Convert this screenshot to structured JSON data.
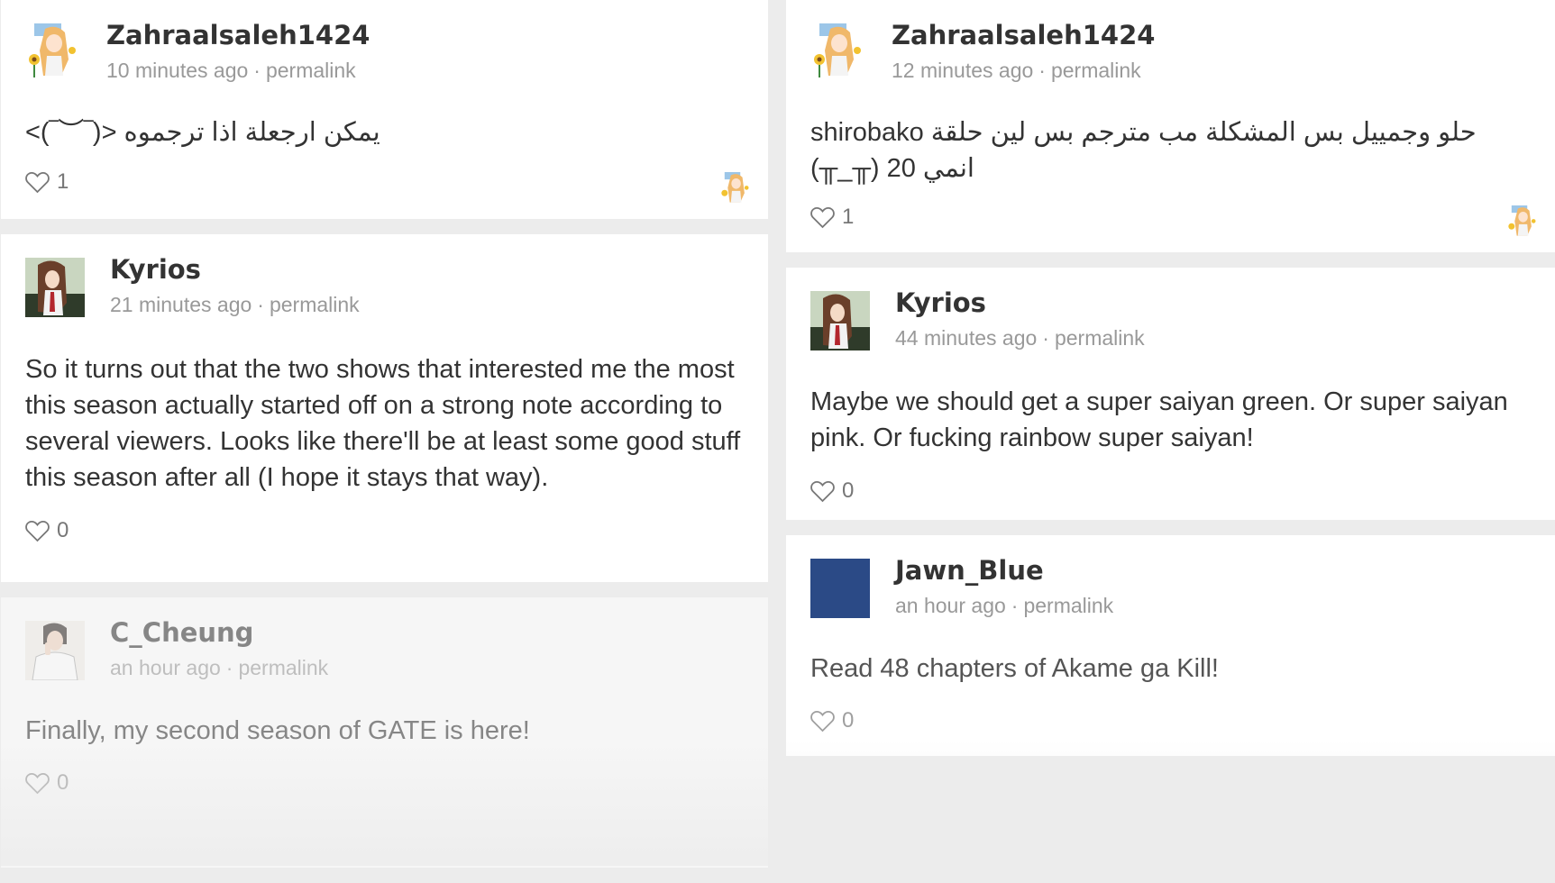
{
  "left_column": [
    {
      "username": "Zahraalsaleh1424",
      "time": "10 minutes ago",
      "separator": "·",
      "permalink": "permalink",
      "text": "يمكن ارجعلة اذا ترجموه <(‾︶‾)>",
      "likes": "1",
      "avatar_icon": "anime-girl-sunflower-avatar",
      "has_liker": true
    },
    {
      "username": "Kyrios",
      "time": "21 minutes ago",
      "separator": "·",
      "permalink": "permalink",
      "text": "So it turns out that the two shows that interested me the most this season actually started off on a strong note according to several viewers. Looks like there'll be at least some good stuff this season after all (I hope it stays that way).",
      "likes": "0",
      "avatar_icon": "anime-girl-dark-hair-avatar"
    },
    {
      "username": "C_Cheung",
      "time": "an hour ago",
      "separator": "·",
      "permalink": "permalink",
      "text": "Finally, my second season of GATE is here!",
      "likes": "0",
      "avatar_icon": "anime-man-white-coat-avatar"
    }
  ],
  "right_column": [
    {
      "username": "Zahraalsaleh1424",
      "time": "12 minutes ago",
      "separator": "·",
      "permalink": "permalink",
      "text": "حلو وجمييل بس المشكلة مب مترجم بس لين حلقة shirobako انمي 20 (╥_╥)",
      "likes": "1",
      "avatar_icon": "anime-girl-sunflower-avatar",
      "has_liker": true
    },
    {
      "username": "Kyrios",
      "time": "44 minutes ago",
      "separator": "·",
      "permalink": "permalink",
      "text": "Maybe we should get a super saiyan green. Or super saiyan pink. Or fucking rainbow super saiyan!",
      "likes": "0",
      "avatar_icon": "anime-girl-dark-hair-avatar"
    },
    {
      "username": "Jawn_Blue",
      "time": "an hour ago",
      "separator": "·",
      "permalink": "permalink",
      "text": "Read 48 chapters of Akame ga Kill!",
      "likes": "0",
      "avatar_icon": "blue-square-avatar",
      "avatar_color": "#2b4a86"
    }
  ],
  "colors": {
    "background": "#ececec",
    "card": "#ffffff",
    "username": "#333333",
    "meta": "#999999",
    "heart": "#777777"
  }
}
